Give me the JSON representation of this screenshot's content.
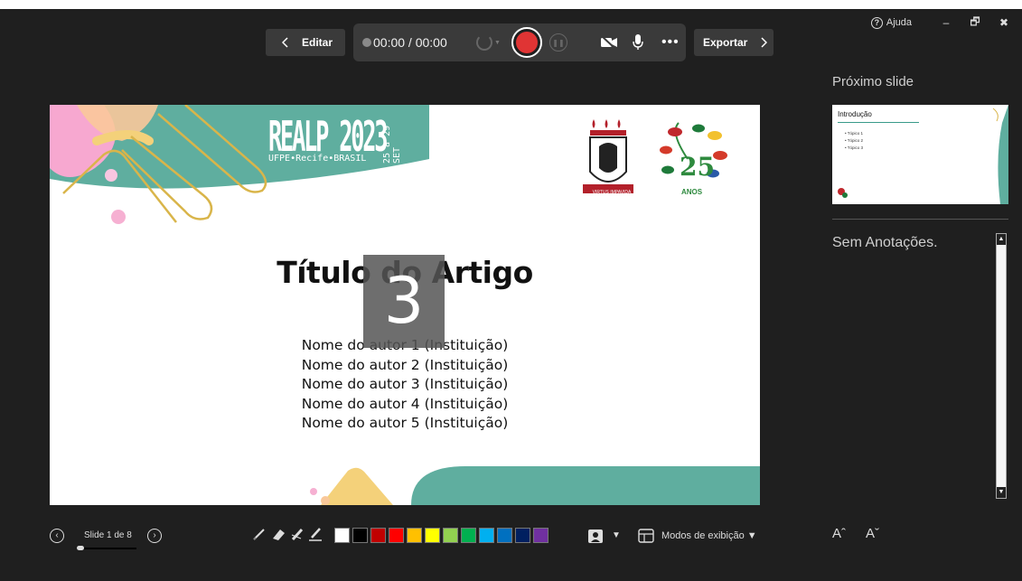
{
  "window": {
    "help_label": "Ajuda",
    "minimize_glyph": "–",
    "restore_glyph": "🗗",
    "close_glyph": "✖"
  },
  "toolbar": {
    "edit_label": "Editar",
    "timer": "00:00 / 00:00",
    "export_label": "Exportar",
    "more_glyph": "•••",
    "record_color": "#e03434"
  },
  "slide": {
    "header_logo": "REALP 2023",
    "header_sub": "UFPE•Recife•BRASIL",
    "header_dates": "25 a 29 SET",
    "title": "Título do Artigo",
    "authors": [
      "Nome do autor 1 (Instituição)",
      "Nome do autor 2 (Instituição)",
      "Nome do autor 3 (Instituição)",
      "Nome do autor 4 (Instituição)",
      "Nome do autor 5 (Instituição)"
    ],
    "countdown": "3",
    "seal_text": "VIRTUS IMPAVIDA",
    "anniversary_number": "25",
    "anniversary_text": "ANOS",
    "accent_color": "#5fae9f"
  },
  "next_slide": {
    "label": "Próximo slide",
    "thumb_title": "Introdução",
    "thumb_bullets": [
      "• Tópico 1",
      "• Tópico 2",
      "• Tópico 3"
    ]
  },
  "notes": {
    "text": "Sem Anotações."
  },
  "font_controls": {
    "increase": "Aˆ",
    "decrease": "Aˇ"
  },
  "navigation": {
    "prev_glyph": "‹",
    "next_glyph": "›",
    "slide_counter": "Slide 1 de 8",
    "progress_fraction": 0.125
  },
  "ink": {
    "colors": [
      "#ffffff",
      "#000000",
      "#c00000",
      "#ff0000",
      "#ffc000",
      "#ffff00",
      "#92d050",
      "#00b050",
      "#00b0f0",
      "#0070c0",
      "#002060",
      "#7030a0"
    ]
  },
  "bottom": {
    "pointer_caret": "▼",
    "modes_label": "Modos de exibição ▼"
  }
}
